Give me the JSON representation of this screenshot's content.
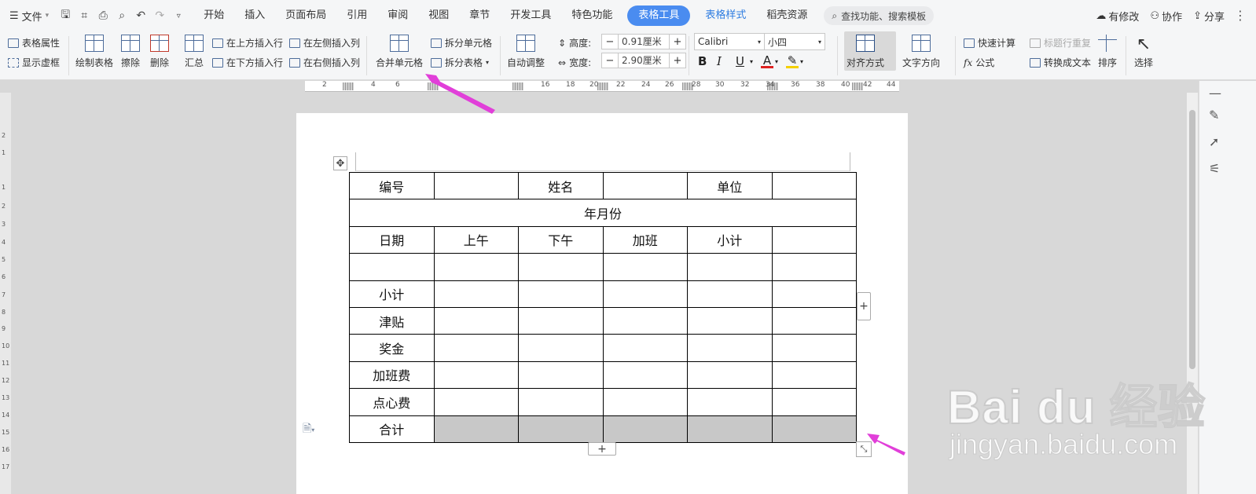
{
  "menubar": {
    "file_label": "文件",
    "tabs": [
      {
        "label": "开始"
      },
      {
        "label": "插入"
      },
      {
        "label": "页面布局"
      },
      {
        "label": "引用"
      },
      {
        "label": "审阅"
      },
      {
        "label": "视图"
      },
      {
        "label": "章节"
      },
      {
        "label": "开发工具"
      },
      {
        "label": "特色功能"
      },
      {
        "label": "表格工具"
      },
      {
        "label": "表格样式"
      },
      {
        "label": "稻壳资源"
      }
    ],
    "search_placeholder": "查找功能、搜索模板",
    "modified_label": "有修改",
    "collab_label": "协作",
    "share_label": "分享"
  },
  "ribbon": {
    "table_props": "表格属性",
    "show_gridlines": "显示虚框",
    "draw_table": "绘制表格",
    "erase": "擦除",
    "delete": "删除",
    "summary": "汇总",
    "insert_above": "在上方插入行",
    "insert_below": "在下方插入行",
    "insert_left": "在左侧插入列",
    "insert_right": "在右侧插入列",
    "merge_cells": "合并单元格",
    "split_cells": "拆分单元格",
    "split_table": "拆分表格",
    "auto_fit": "自动调整",
    "height_label": "高度:",
    "height_value": "0.91厘米",
    "width_label": "宽度:",
    "width_value": "2.90厘米",
    "font_name": "Calibri",
    "font_size": "小四",
    "align": "对齐方式",
    "text_direction": "文字方向",
    "quick_calc": "快速计算",
    "repeat_header": "标题行重复",
    "formula": "公式",
    "to_text": "转换成文本",
    "sort": "排序",
    "select": "选择"
  },
  "ruler": {
    "h_numbers": [
      "2",
      "2",
      "4",
      "6",
      "16",
      "18",
      "20",
      "22",
      "24",
      "26",
      "28",
      "30",
      "32",
      "34",
      "36",
      "38",
      "40",
      "42",
      "44"
    ],
    "v_numbers": [
      "2",
      "1",
      "1",
      "2",
      "3",
      "4",
      "5",
      "6",
      "7",
      "8",
      "9",
      "10",
      "11",
      "12",
      "13",
      "14",
      "15",
      "16",
      "17"
    ]
  },
  "table": {
    "rows": [
      [
        "编号",
        "",
        "姓名",
        "",
        "单位",
        ""
      ],
      [
        "年月份"
      ],
      [
        "日期",
        "上午",
        "下午",
        "加班",
        "小计",
        ""
      ],
      [
        "",
        "",
        "",
        "",
        "",
        ""
      ],
      [
        "小计",
        "",
        "",
        "",
        "",
        ""
      ],
      [
        "津贴",
        "",
        "",
        "",
        "",
        ""
      ],
      [
        "奖金",
        "",
        "",
        "",
        "",
        ""
      ],
      [
        "加班费",
        "",
        "",
        "",
        "",
        ""
      ],
      [
        "点心费",
        "",
        "",
        "",
        "",
        ""
      ],
      [
        "合计",
        "",
        "",
        "",
        "",
        ""
      ]
    ]
  },
  "watermark": {
    "brand": "Bai du 经验",
    "url": "jingyan.baidu.com"
  },
  "colors": {
    "accent": "#4a8cf0",
    "arrow": "#e13fd9",
    "selected_cells": "#c8c8c8"
  }
}
